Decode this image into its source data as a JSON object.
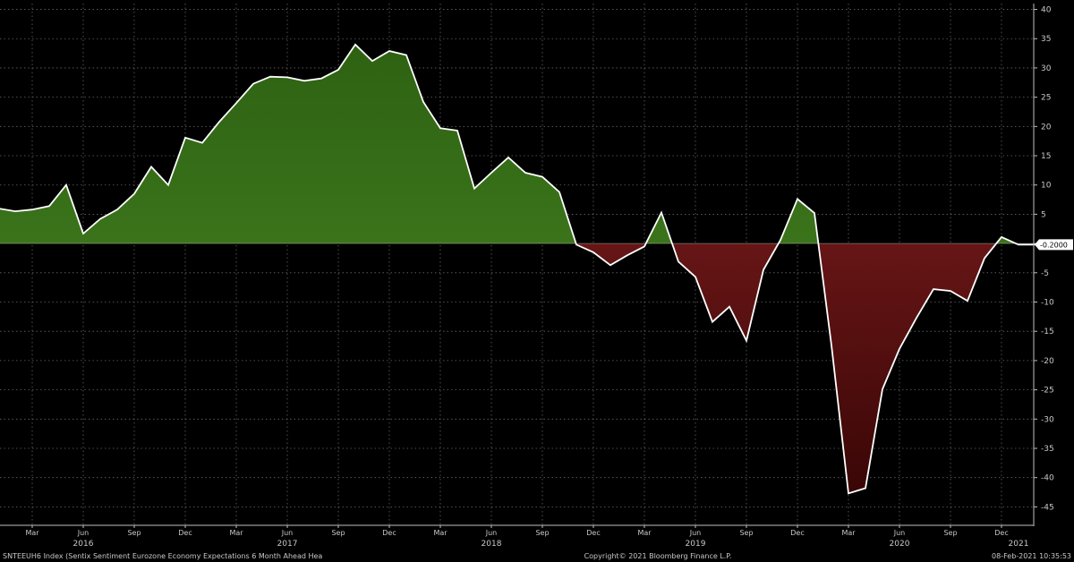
{
  "chart_data": {
    "type": "area",
    "x": [
      "2016-01",
      "2016-02",
      "2016-03",
      "2016-04",
      "2016-05",
      "2016-06",
      "2016-07",
      "2016-08",
      "2016-09",
      "2016-10",
      "2016-11",
      "2016-12",
      "2017-01",
      "2017-02",
      "2017-03",
      "2017-04",
      "2017-05",
      "2017-06",
      "2017-07",
      "2017-08",
      "2017-09",
      "2017-10",
      "2017-11",
      "2017-12",
      "2018-01",
      "2018-02",
      "2018-03",
      "2018-04",
      "2018-05",
      "2018-06",
      "2018-07",
      "2018-08",
      "2018-09",
      "2018-10",
      "2018-11",
      "2018-12",
      "2019-01",
      "2019-02",
      "2019-03",
      "2019-04",
      "2019-05",
      "2019-06",
      "2019-07",
      "2019-08",
      "2019-09",
      "2019-10",
      "2019-11",
      "2019-12",
      "2020-01",
      "2020-02",
      "2020-03",
      "2020-04",
      "2020-05",
      "2020-06",
      "2020-07",
      "2020-08",
      "2020-09",
      "2020-10",
      "2020-11",
      "2020-12",
      "2021-01",
      "2021-02"
    ],
    "series": [
      {
        "name": "",
        "values": [
          6.0,
          5.5,
          5.8,
          6.4,
          10.0,
          1.7,
          4.2,
          5.8,
          8.5,
          13.1,
          10.0,
          18.1,
          17.2,
          20.8,
          24.0,
          27.3,
          28.5,
          28.4,
          27.8,
          28.2,
          29.7,
          34.0,
          31.2,
          32.9,
          32.2,
          24.2,
          19.7,
          19.3,
          9.4,
          12.1,
          14.7,
          12.1,
          11.4,
          8.8,
          -0.2,
          -1.5,
          -3.7,
          -2.0,
          -0.5,
          5.3,
          -3.1,
          -5.7,
          -13.4,
          -10.8,
          -16.6,
          -4.5,
          0.6,
          7.6,
          5.2,
          -17.4,
          -42.7,
          -41.8,
          -24.9,
          -18.0,
          -12.7,
          -7.8,
          -8.1,
          -9.8,
          -2.5,
          1.1,
          -0.2,
          -0.2
        ]
      }
    ],
    "ylim": [
      -48,
      41
    ],
    "y_ticks": [
      40,
      35,
      30,
      25,
      20,
      15,
      10,
      5,
      0,
      -5,
      -10,
      -15,
      -20,
      -25,
      -30,
      -35,
      -40,
      -45
    ],
    "x_month_ticks": [
      {
        "at": "2016-03",
        "label": "Mar"
      },
      {
        "at": "2016-06",
        "label": "Jun"
      },
      {
        "at": "2016-09",
        "label": "Sep"
      },
      {
        "at": "2016-12",
        "label": "Dec"
      },
      {
        "at": "2017-03",
        "label": "Mar"
      },
      {
        "at": "2017-06",
        "label": "Jun"
      },
      {
        "at": "2017-09",
        "label": "Sep"
      },
      {
        "at": "2017-12",
        "label": "Dec"
      },
      {
        "at": "2018-03",
        "label": "Mar"
      },
      {
        "at": "2018-06",
        "label": "Jun"
      },
      {
        "at": "2018-09",
        "label": "Sep"
      },
      {
        "at": "2018-12",
        "label": "Dec"
      },
      {
        "at": "2019-03",
        "label": "Mar"
      },
      {
        "at": "2019-06",
        "label": "Jun"
      },
      {
        "at": "2019-09",
        "label": "Sep"
      },
      {
        "at": "2019-12",
        "label": "Dec"
      },
      {
        "at": "2020-03",
        "label": "Mar"
      },
      {
        "at": "2020-06",
        "label": "Jun"
      },
      {
        "at": "2020-09",
        "label": "Sep"
      },
      {
        "at": "2020-12",
        "label": "Dec"
      }
    ],
    "x_year_labels": [
      {
        "at": "2016-06",
        "label": "2016"
      },
      {
        "at": "2017-06",
        "label": "2017"
      },
      {
        "at": "2018-06",
        "label": "2018"
      },
      {
        "at": "2019-06",
        "label": "2019"
      },
      {
        "at": "2020-06",
        "label": "2020"
      },
      {
        "at": "2021-01",
        "label": "2021"
      }
    ],
    "last_value_label": "-0.2000",
    "grid": true,
    "colors": {
      "positive_fill_top": "#2e6212",
      "positive_fill_bottom": "#4a8a26",
      "negative_fill_top": "#8a2222",
      "negative_fill_bottom": "#3a0606",
      "line": "#ffffff",
      "grid": "#666666",
      "background": "#000000"
    }
  },
  "footer": {
    "left": "SNTEEUH6 Index (Sentix Sentiment Eurozone Economy Expectations 6 Month Ahead Hea",
    "center": "Copyright© 2021 Bloomberg Finance L.P.",
    "right": "08-Feb-2021 10:35:53"
  }
}
